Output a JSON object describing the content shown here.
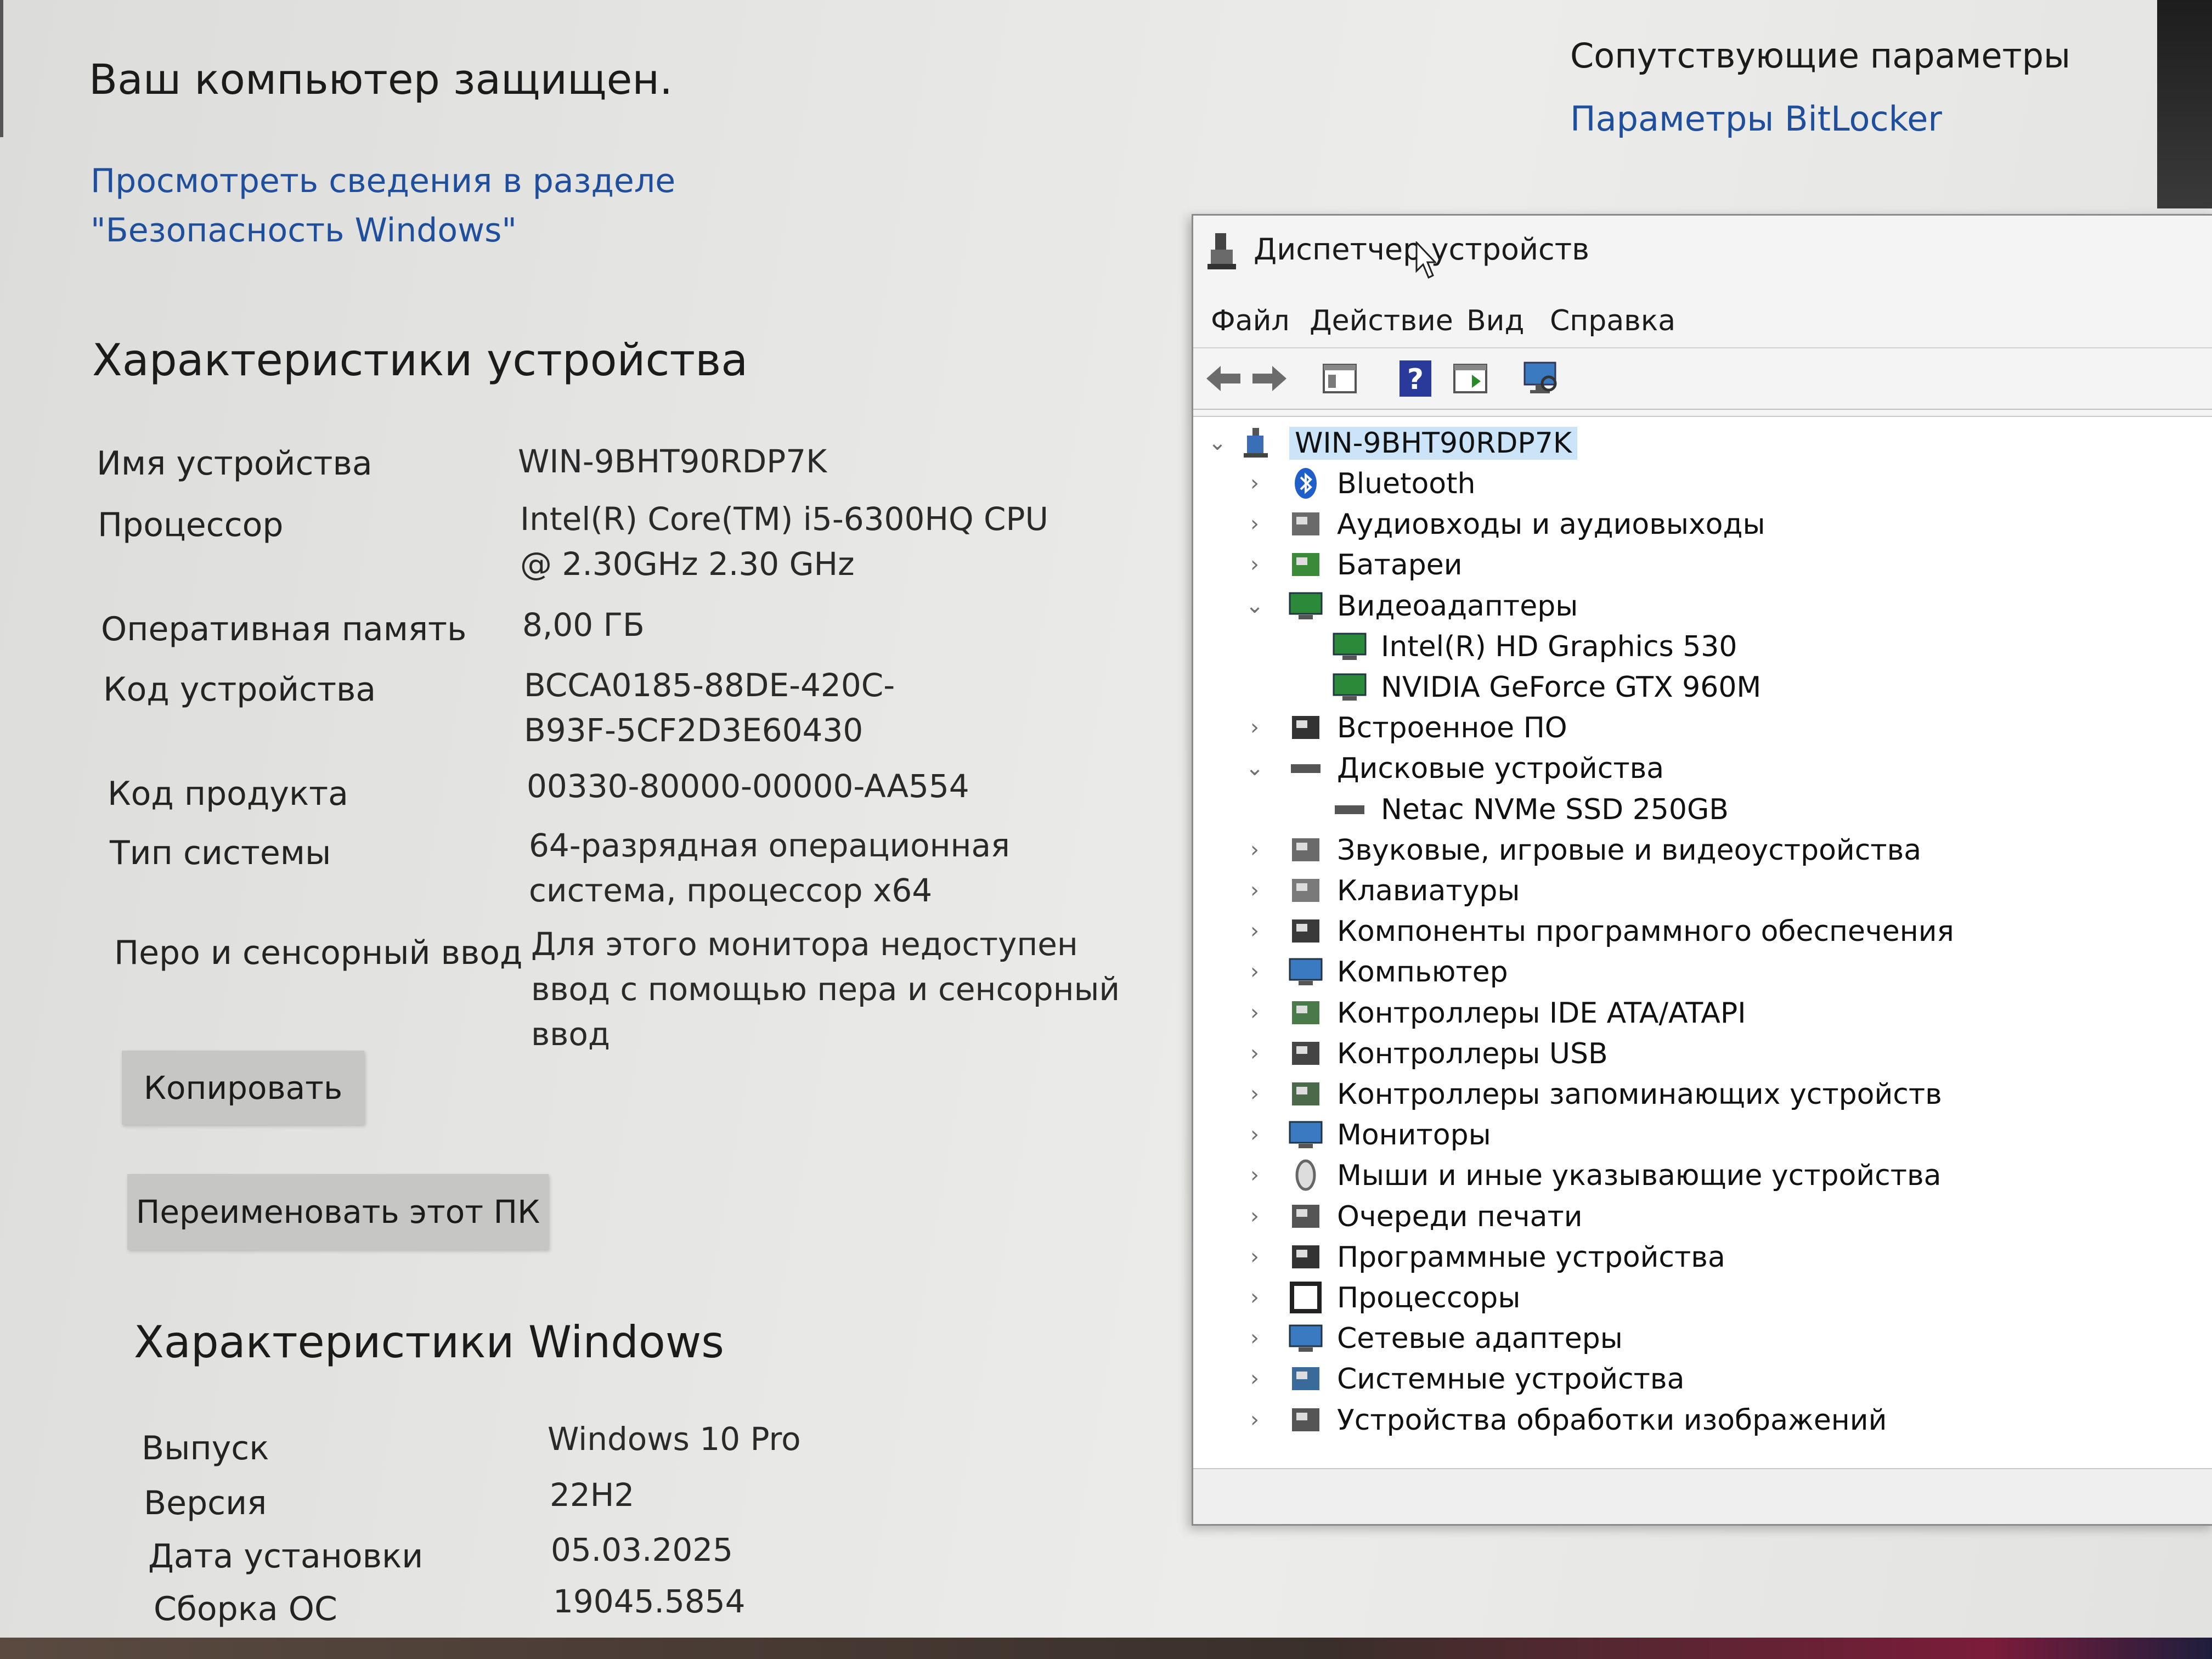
{
  "system": {
    "protected_text": "Ваш компьютер защищен.",
    "security_link": "Просмотреть сведения в разделе \"Безопасность Windows\"",
    "device_specs_title": "Характеристики устройства",
    "specs": [
      {
        "label": "Имя устройства",
        "value": "WIN-9BHT90RDP7K"
      },
      {
        "label": "Процессор",
        "value": "Intel(R) Core(TM) i5-6300HQ CPU @ 2.30GHz   2.30 GHz"
      },
      {
        "label": "Оперативная память",
        "value": "8,00 ГБ"
      },
      {
        "label": "Код устройства",
        "value": "BCCA0185-88DE-420C-B93F-5CF2D3E60430"
      },
      {
        "label": "Код продукта",
        "value": "00330-80000-00000-AA554"
      },
      {
        "label": "Тип системы",
        "value": "64-разрядная операционная система, процессор x64"
      },
      {
        "label": "Перо и сенсорный ввод",
        "value": "Для этого монитора недоступен ввод с помощью пера и сенсорный ввод"
      }
    ],
    "copy_button": "Копировать",
    "rename_button": "Переименовать этот ПК",
    "windows_specs_title": "Характеристики Windows",
    "windows_specs": [
      {
        "label": "Выпуск",
        "value": "Windows 10 Pro"
      },
      {
        "label": "Версия",
        "value": "22H2"
      },
      {
        "label": "Дата установки",
        "value": "05.03.2025"
      },
      {
        "label": "Сборка ОС",
        "value": "19045.5854"
      }
    ],
    "related_title": "Сопутствующие параметры",
    "related_link": "Параметры BitLocker"
  },
  "device_manager": {
    "title": "Диспетчер устройств",
    "menu": [
      "Файл",
      "Действие",
      "Вид",
      "Справка"
    ],
    "root": "WIN-9BHT90RDP7K",
    "tree": [
      {
        "label": "Bluetooth",
        "icon": "bluetooth-icon",
        "expanded": false,
        "level": 1
      },
      {
        "label": "Аудиовходы и аудиовыходы",
        "icon": "speaker-icon",
        "expanded": false,
        "level": 1
      },
      {
        "label": "Батареи",
        "icon": "battery-icon",
        "expanded": false,
        "level": 1
      },
      {
        "label": "Видеоадаптеры",
        "icon": "display-adapter-icon",
        "expanded": true,
        "level": 1
      },
      {
        "label": "Intel(R) HD Graphics 530",
        "icon": "display-adapter-icon",
        "level": 2
      },
      {
        "label": "NVIDIA GeForce GTX 960M",
        "icon": "display-adapter-icon",
        "level": 2
      },
      {
        "label": "Встроенное ПО",
        "icon": "firmware-icon",
        "expanded": false,
        "level": 1
      },
      {
        "label": "Дисковые устройства",
        "icon": "disk-drive-icon",
        "expanded": true,
        "level": 1
      },
      {
        "label": "Netac NVMe SSD 250GB",
        "icon": "disk-drive-icon",
        "level": 2
      },
      {
        "label": "Звуковые, игровые и видеоустройства",
        "icon": "speaker-icon",
        "expanded": false,
        "level": 1
      },
      {
        "label": "Клавиатуры",
        "icon": "keyboard-icon",
        "expanded": false,
        "level": 1
      },
      {
        "label": "Компоненты программного обеспечения",
        "icon": "software-component-icon",
        "expanded": false,
        "level": 1
      },
      {
        "label": "Компьютер",
        "icon": "computer-icon",
        "expanded": false,
        "level": 1
      },
      {
        "label": "Контроллеры IDE ATA/ATAPI",
        "icon": "ide-controller-icon",
        "expanded": false,
        "level": 1
      },
      {
        "label": "Контроллеры USB",
        "icon": "usb-icon",
        "expanded": false,
        "level": 1
      },
      {
        "label": "Контроллеры запоминающих устройств",
        "icon": "storage-controller-icon",
        "expanded": false,
        "level": 1
      },
      {
        "label": "Мониторы",
        "icon": "monitor-icon",
        "expanded": false,
        "level": 1
      },
      {
        "label": "Мыши и иные указывающие устройства",
        "icon": "mouse-icon",
        "expanded": false,
        "level": 1
      },
      {
        "label": "Очереди печати",
        "icon": "printer-icon",
        "expanded": false,
        "level": 1
      },
      {
        "label": "Программные устройства",
        "icon": "software-device-icon",
        "expanded": false,
        "level": 1
      },
      {
        "label": "Процессоры",
        "icon": "processor-icon",
        "expanded": false,
        "level": 1
      },
      {
        "label": "Сетевые адаптеры",
        "icon": "network-adapter-icon",
        "expanded": false,
        "level": 1
      },
      {
        "label": "Системные устройства",
        "icon": "system-device-icon",
        "expanded": false,
        "level": 1
      },
      {
        "label": "Устройства обработки изображений",
        "icon": "imaging-device-icon",
        "expanded": false,
        "level": 1
      }
    ]
  }
}
